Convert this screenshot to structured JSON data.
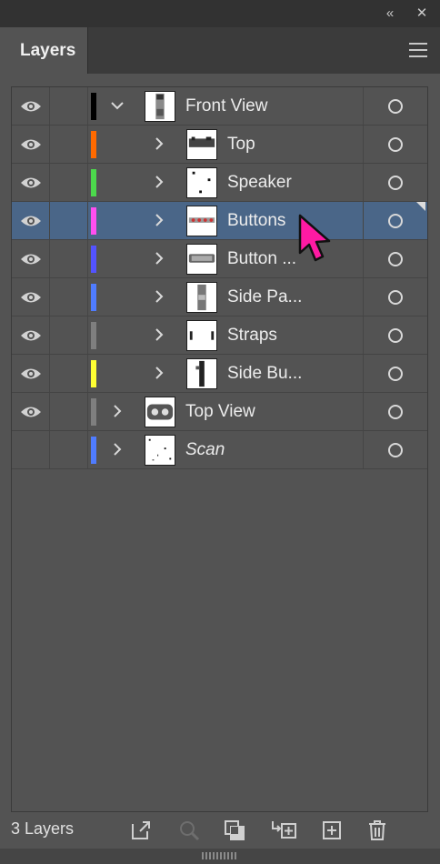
{
  "window": {
    "collapse_icon": "double-chevron-left",
    "close_icon": "close-x"
  },
  "tab": {
    "label": "Layers"
  },
  "accent": {
    "selection": "#4a6688",
    "cursor": "#ff1aa3"
  },
  "layers": [
    {
      "name": "Front View",
      "level": 0,
      "visible": true,
      "expanded": true,
      "color": "#000000",
      "selected": false,
      "italic": false
    },
    {
      "name": "Top",
      "level": 1,
      "visible": true,
      "expanded": false,
      "color": "#ff6a00",
      "selected": false,
      "italic": false
    },
    {
      "name": "Speaker",
      "level": 1,
      "visible": true,
      "expanded": false,
      "color": "#4cd94c",
      "selected": false,
      "italic": false
    },
    {
      "name": "Buttons",
      "level": 1,
      "visible": true,
      "expanded": false,
      "color": "#ff4ff0",
      "selected": true,
      "italic": false
    },
    {
      "name": "Button ...",
      "level": 1,
      "visible": true,
      "expanded": false,
      "color": "#5353ff",
      "selected": false,
      "italic": false
    },
    {
      "name": "Side Pa...",
      "level": 1,
      "visible": true,
      "expanded": false,
      "color": "#4f7cff",
      "selected": false,
      "italic": false
    },
    {
      "name": "Straps",
      "level": 1,
      "visible": true,
      "expanded": false,
      "color": "#7f7f7f",
      "selected": false,
      "italic": false
    },
    {
      "name": "Side Bu...",
      "level": 1,
      "visible": true,
      "expanded": false,
      "color": "#ffff33",
      "selected": false,
      "italic": false
    },
    {
      "name": "Top View",
      "level": 0,
      "visible": true,
      "expanded": false,
      "color": "#7f7f7f",
      "selected": false,
      "italic": false
    },
    {
      "name": "Scan",
      "level": 0,
      "visible": false,
      "expanded": false,
      "color": "#4f7cff",
      "selected": false,
      "italic": true
    }
  ],
  "footer": {
    "count_label": "3 Layers",
    "buttons": [
      "export-for-screens-icon",
      "locate-object-icon",
      "make-clipping-mask-icon",
      "create-sublayer-icon",
      "create-new-layer-icon",
      "delete-layer-icon"
    ]
  }
}
